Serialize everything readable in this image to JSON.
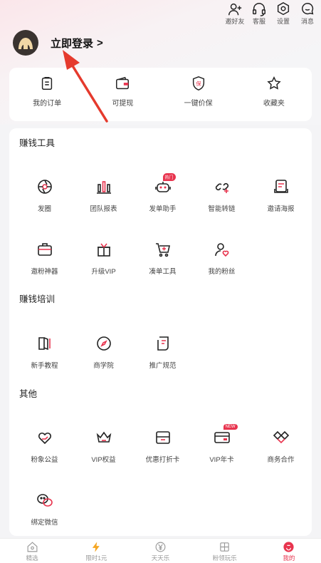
{
  "header_actions": [
    {
      "label": "邀好友",
      "icon": "add-user-icon"
    },
    {
      "label": "客服",
      "icon": "headset-icon"
    },
    {
      "label": "设置",
      "icon": "gear-icon"
    },
    {
      "label": "消息",
      "icon": "message-icon"
    }
  ],
  "profile": {
    "login_text": "立即登录",
    "chevron": ">"
  },
  "quick_actions": [
    {
      "label": "我的订单",
      "icon": "order-icon"
    },
    {
      "label": "可提现",
      "icon": "wallet-icon"
    },
    {
      "label": "一键价保",
      "icon": "price-protect-icon"
    },
    {
      "label": "收藏夹",
      "icon": "star-icon"
    }
  ],
  "sections": {
    "tools": {
      "title": "赚钱工具",
      "items": [
        {
          "label": "发圈",
          "icon": "aperture-icon"
        },
        {
          "label": "团队报表",
          "icon": "bar-chart-icon"
        },
        {
          "label": "发单助手",
          "icon": "robot-icon",
          "badge": "热门"
        },
        {
          "label": "智能转链",
          "icon": "link-icon"
        },
        {
          "label": "邀请海报",
          "icon": "poster-icon"
        },
        {
          "label": "邀粉神器",
          "icon": "briefcase-icon"
        },
        {
          "label": "升级VIP",
          "icon": "gift-icon"
        },
        {
          "label": "凑单工具",
          "icon": "cart-icon"
        },
        {
          "label": "我的粉丝",
          "icon": "fans-icon"
        }
      ]
    },
    "training": {
      "title": "赚钱培训",
      "items": [
        {
          "label": "新手教程",
          "icon": "book-icon"
        },
        {
          "label": "商学院",
          "icon": "compass-icon"
        },
        {
          "label": "推广规范",
          "icon": "document-icon"
        }
      ]
    },
    "other": {
      "title": "其他",
      "items": [
        {
          "label": "粉象公益",
          "icon": "heart-hand-icon"
        },
        {
          "label": "VIP权益",
          "icon": "crown-icon"
        },
        {
          "label": "优惠打折卡",
          "icon": "coupon-icon"
        },
        {
          "label": "VIP年卡",
          "icon": "card-icon",
          "badge": "NEW"
        },
        {
          "label": "商务合作",
          "icon": "handshake-icon"
        },
        {
          "label": "绑定微信",
          "icon": "wechat-icon"
        }
      ]
    }
  },
  "tabbar": [
    {
      "label": "精选",
      "icon": "home-icon",
      "active": false
    },
    {
      "label": "限时1元",
      "icon": "lightning-icon",
      "active": false
    },
    {
      "label": "天天乐",
      "icon": "yuan-icon",
      "active": false
    },
    {
      "label": "粉领玩乐",
      "icon": "grid-icon",
      "active": false
    },
    {
      "label": "我的",
      "icon": "user-circle-icon",
      "active": true
    }
  ],
  "colors": {
    "accent": "#e8344e",
    "text": "#333333",
    "card": "#ffffff",
    "bg": "#f4f4f6"
  }
}
